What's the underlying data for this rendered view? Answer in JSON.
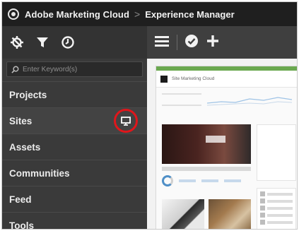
{
  "header": {
    "brand": "Adobe Marketing Cloud",
    "separator": ">",
    "product": "Experience Manager"
  },
  "rail": {
    "tools": [
      "compass-icon",
      "filter-icon",
      "clock-icon"
    ],
    "search": {
      "placeholder": "Enter Keyword(s)",
      "value": ""
    },
    "items": [
      {
        "label": "Projects"
      },
      {
        "label": "Sites"
      },
      {
        "label": "Assets"
      },
      {
        "label": "Communities"
      },
      {
        "label": "Feed"
      },
      {
        "label": "Tools"
      }
    ]
  },
  "main": {
    "toolbar": [
      "menu-icon",
      "check-circle-icon",
      "add-icon"
    ],
    "thumbnail": {
      "title": "Site Marketing Cloud"
    }
  },
  "colors": {
    "highlight": "#e0161b",
    "accent_green": "#6aa84f"
  }
}
